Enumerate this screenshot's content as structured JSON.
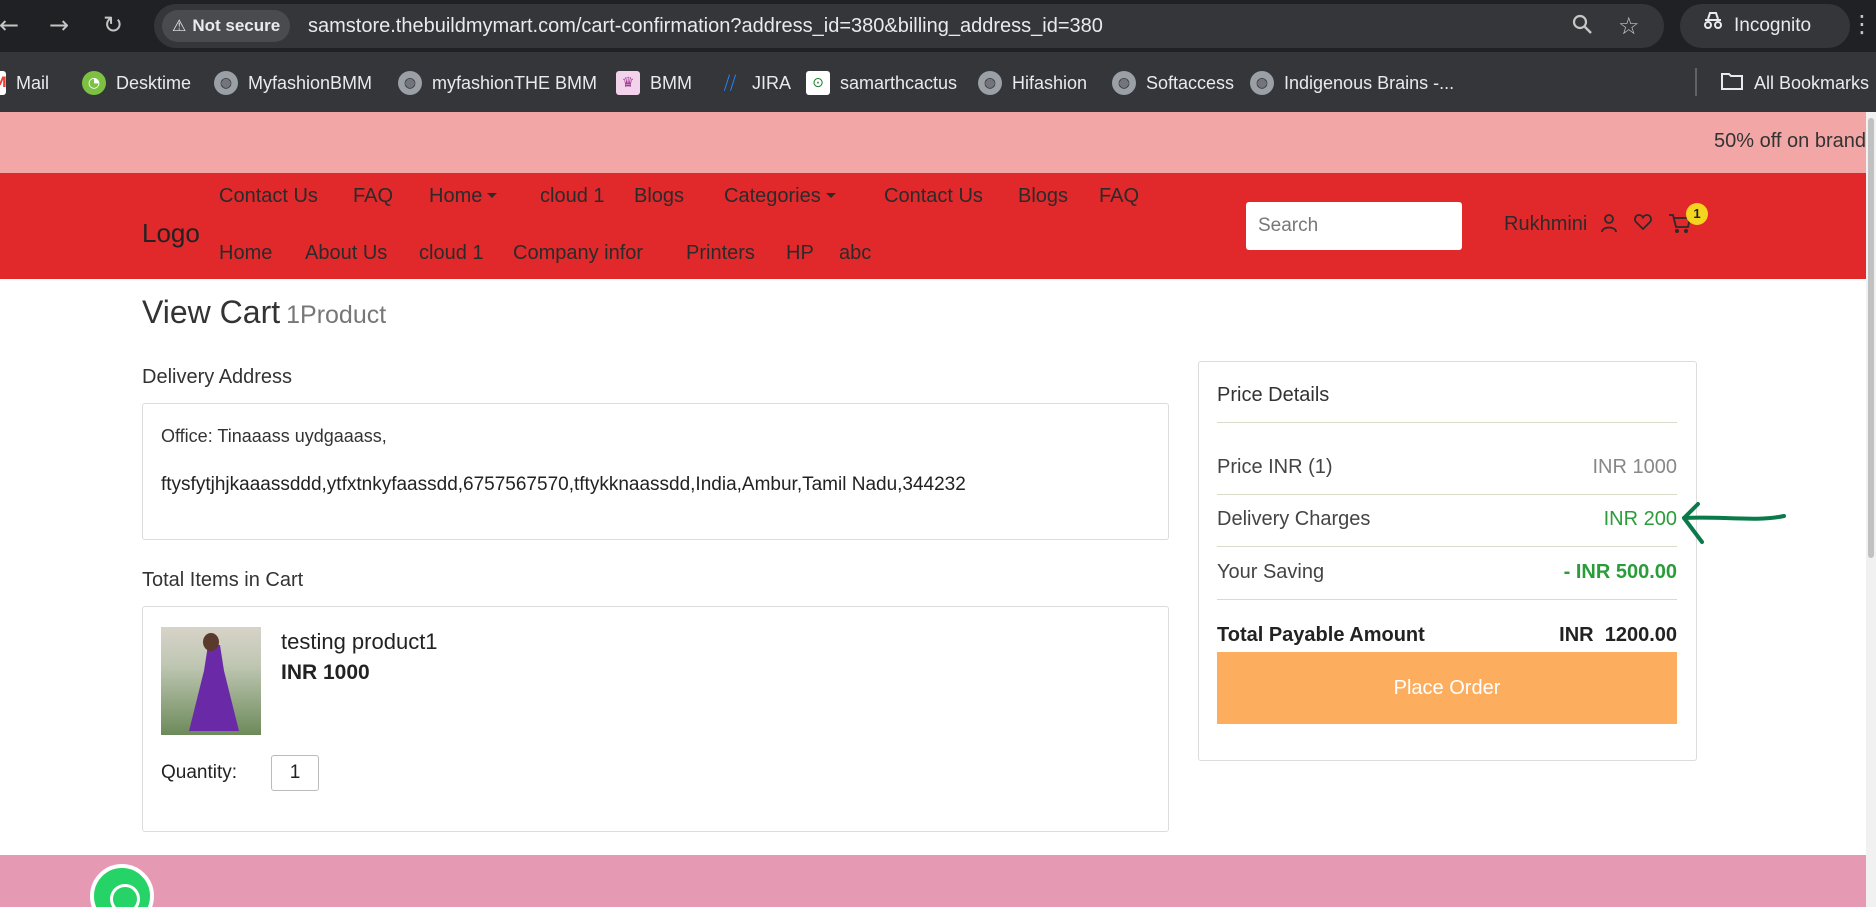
{
  "browser": {
    "security_label": "Not secure",
    "url": "samstore.thebuildmymart.com/cart-confirmation?address_id=380&billing_address_id=380",
    "incognito_label": "Incognito",
    "bookmarks": [
      {
        "label": "Mail",
        "icon": "gmail-icon"
      },
      {
        "label": "Desktime",
        "icon": "desktime-icon"
      },
      {
        "label": "MyfashionBMM",
        "icon": "globe-icon"
      },
      {
        "label": "myfashionTHE BMM",
        "icon": "globe-icon"
      },
      {
        "label": "BMM",
        "icon": "bmm-icon"
      },
      {
        "label": "JIRA",
        "icon": "jira-icon"
      },
      {
        "label": "samarthcactus",
        "icon": "cactus-icon"
      },
      {
        "label": "Hifashion",
        "icon": "globe-icon"
      },
      {
        "label": "Softaccess",
        "icon": "globe-icon"
      },
      {
        "label": "Indigenous Brains -...",
        "icon": "globe-icon"
      }
    ],
    "all_bookmarks_label": "All Bookmarks"
  },
  "promo": {
    "text": "50% off on brand"
  },
  "header": {
    "logo": "Logo",
    "menu_row1": [
      "Contact Us",
      "FAQ",
      "Home",
      "cloud 1",
      "Blogs",
      "Categories",
      "Contact Us",
      "Blogs",
      "FAQ"
    ],
    "menu_row2": [
      "Home",
      "About Us",
      "cloud 1",
      "Company infor",
      "Printers",
      "HP",
      "abc"
    ],
    "search_placeholder": "Search",
    "user_name": "Rukhmini",
    "cart_count": "1"
  },
  "cart": {
    "title": "View Cart",
    "product_count": "1Product",
    "delivery_address_title": "Delivery Address",
    "address_line1": "Office: Tinaaass uydgaaass,",
    "address_line2": "ftysfytjhjkaaassddd,ytfxtnkyfaassdd,6757567570,tftykknaassdd,India,Ambur,Tamil Nadu,344232",
    "items_title": "Total Items in Cart",
    "item": {
      "name": "testing product1",
      "price": "INR 1000",
      "quantity_label": "Quantity:",
      "quantity": "1"
    }
  },
  "price_details": {
    "title": "Price Details",
    "rows": [
      {
        "label": "Price INR (1)",
        "value": "INR 1000"
      },
      {
        "label": "Delivery Charges",
        "value": "INR 200"
      },
      {
        "label": "Your Saving",
        "value": "- INR 500.00"
      }
    ],
    "total_label": "Total Payable Amount",
    "total_value": "INR  1200.00",
    "place_order_label": "Place Order"
  },
  "colors": {
    "header_red": "#e1282a",
    "promo_pink": "#f2a7a6",
    "green": "#2a9d3a",
    "place_order_orange": "#fcae5e",
    "annotation_arrow": "#0a7a4a"
  }
}
